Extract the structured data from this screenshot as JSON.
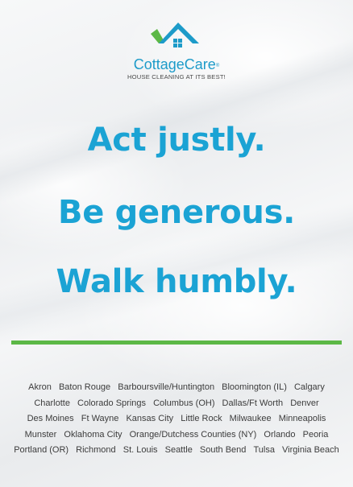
{
  "brand": {
    "name": "CottageCare",
    "trademark": "®",
    "tagline": "HOUSE CLEANING AT ITS BEST!"
  },
  "headlines": [
    "Act justly.",
    "Be generous.",
    "Walk humbly."
  ],
  "colors": {
    "roof": "#1d9bc9",
    "roof_accent": "#5cb846",
    "headline": "#1ba3d4",
    "divider": "#5cb846",
    "text": "#3c3c3c"
  },
  "locations": [
    "Akron",
    "Baton Rouge",
    "Barboursville/Huntington",
    "Bloomington (IL)",
    "Calgary",
    "Charlotte",
    "Colorado Springs",
    "Columbus (OH)",
    "Dallas/Ft Worth",
    "Denver",
    "Des Moines",
    "Ft Wayne",
    "Kansas City",
    "Little Rock",
    "Milwaukee",
    "Minneapolis",
    "Munster",
    "Oklahoma City",
    "Orange/Dutchess Counties (NY)",
    "Orlando",
    "Peoria",
    "Portland (OR)",
    "Richmond",
    "St. Louis",
    "Seattle",
    "South Bend",
    "Tulsa",
    "Virginia Beach"
  ]
}
